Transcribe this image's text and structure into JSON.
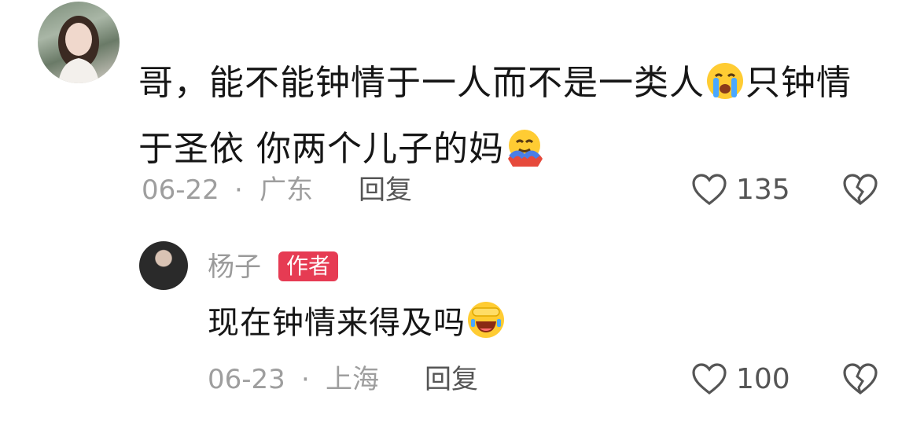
{
  "comment": {
    "text_part1": "哥，能不能钟情于一人而不是一类人",
    "emoji1": "crying-face-icon",
    "text_part2": "只钟情于圣依 你两个儿子的妈",
    "emoji2": "hugging-face-icon",
    "date": "06-22",
    "separator": "·",
    "location": "广东",
    "reply_label": "回复",
    "likes": "135"
  },
  "reply": {
    "author": "杨子",
    "badge": "作者",
    "text": "现在钟情来得及吗",
    "emoji": "laughing-face-icon",
    "date": "06-23",
    "separator": "·",
    "location": "上海",
    "reply_label": "回复",
    "likes": "100"
  },
  "colors": {
    "badge": "#e63b53",
    "meta": "#9e9e9e",
    "text": "#161616"
  }
}
